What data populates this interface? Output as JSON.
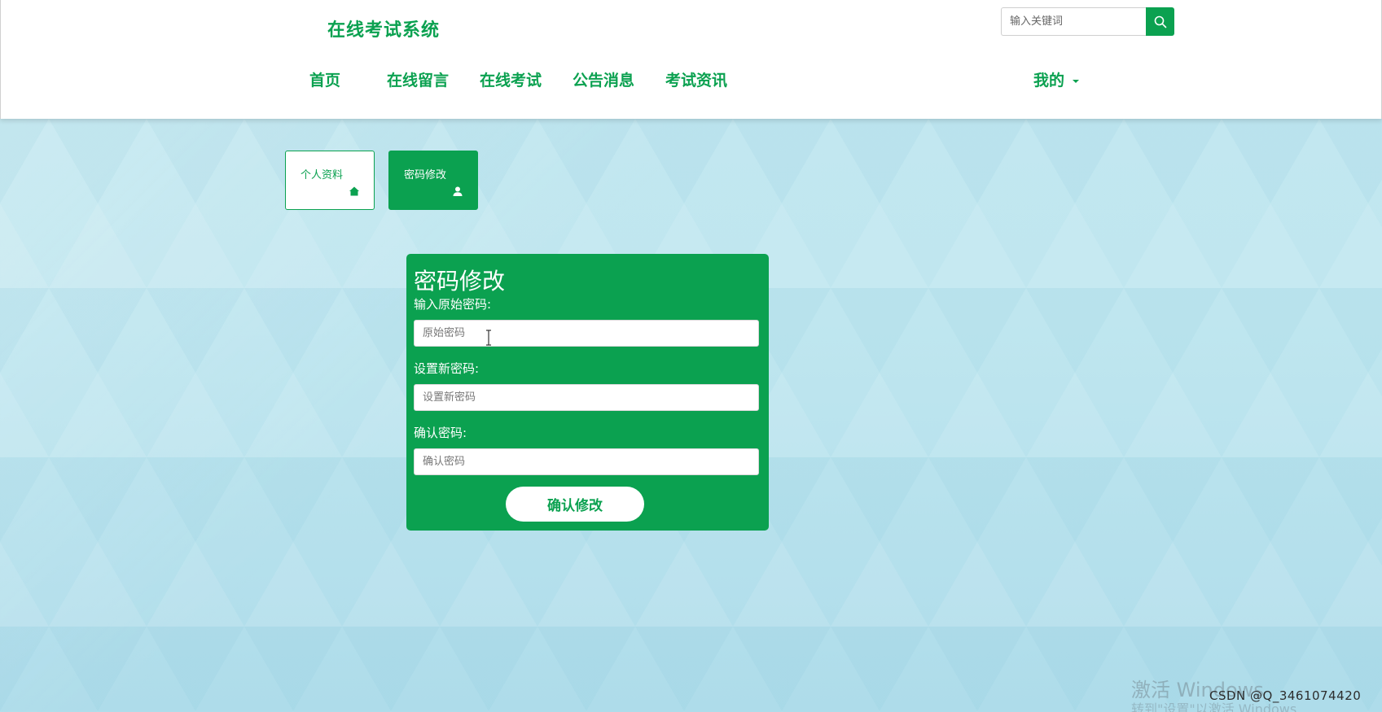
{
  "header": {
    "brand": "在线考试系统",
    "search": {
      "placeholder": "输入关键词"
    },
    "nav": [
      "首页",
      "在线留言",
      "在线考试",
      "公告消息",
      "考试资讯"
    ],
    "me": "我的"
  },
  "tabs": {
    "profile": "个人资料",
    "password": "密码修改"
  },
  "form": {
    "title": "密码修改",
    "old_label": "输入原始密码:",
    "old_placeholder": "原始密码",
    "new_label": "设置新密码:",
    "new_placeholder": "设置新密码",
    "confirm_label": "确认密码:",
    "confirm_placeholder": "确认密码",
    "submit": "确认修改"
  },
  "overlay": {
    "windows_watermark": "激活 Windows",
    "windows_watermark_sub": "转到\"设置\"以激活 Windows",
    "csdn": "CSDN @Q_3461074420"
  },
  "colors": {
    "accent": "#0ba150"
  }
}
